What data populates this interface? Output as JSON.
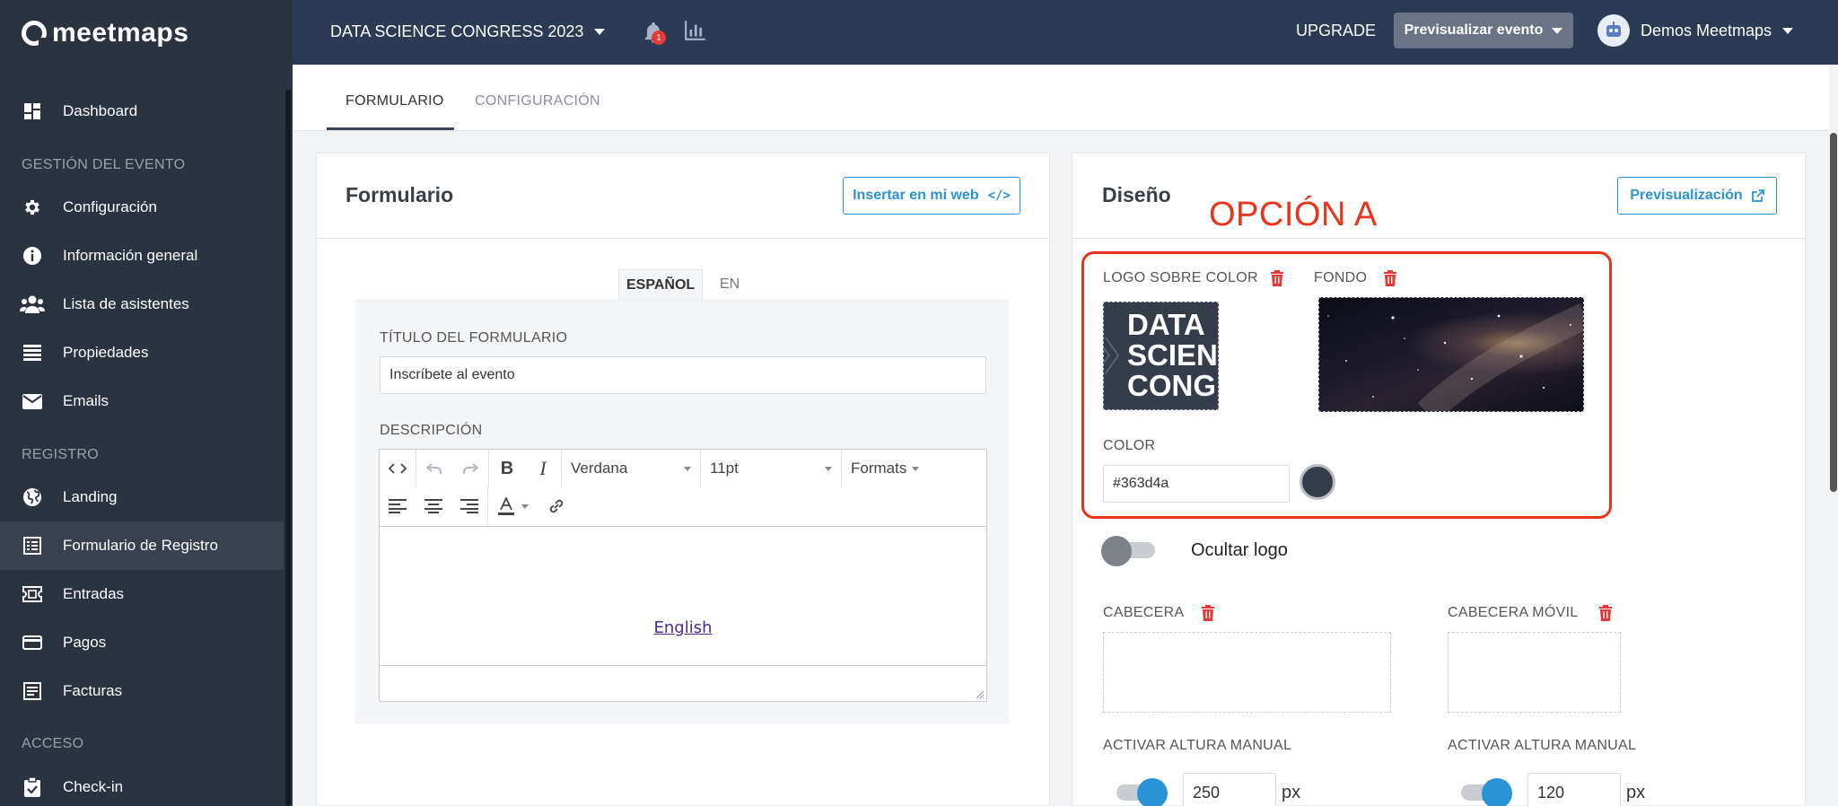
{
  "app": {
    "logo_text": "meetmaps"
  },
  "sidebar": {
    "items": [
      {
        "label": "Dashboard",
        "icon": "dashboard-icon"
      },
      {
        "label": "Configuración",
        "icon": "gear-icon"
      },
      {
        "label": "Información general",
        "icon": "info-icon"
      },
      {
        "label": "Lista de asistentes",
        "icon": "users-icon"
      },
      {
        "label": "Propiedades",
        "icon": "list-icon"
      },
      {
        "label": "Emails",
        "icon": "mail-icon"
      },
      {
        "label": "Landing",
        "icon": "globe-icon"
      },
      {
        "label": "Formulario de Registro",
        "icon": "form-icon"
      },
      {
        "label": "Entradas",
        "icon": "ticket-icon"
      },
      {
        "label": "Pagos",
        "icon": "card-icon"
      },
      {
        "label": "Facturas",
        "icon": "invoice-icon"
      },
      {
        "label": "Check-in",
        "icon": "clipboard-check-icon"
      }
    ],
    "sections": [
      "GESTIÓN DEL EVENTO",
      "REGISTRO",
      "ACCESO"
    ],
    "active_item": "Formulario de Registro"
  },
  "topbar": {
    "event_title": "DATA SCIENCE CONGRESS 2023",
    "notifications_count": "1",
    "upgrade": "UPGRADE",
    "preview_event": "Previsualizar evento",
    "user_name": "Demos Meetmaps"
  },
  "tabs": [
    "FORMULARIO",
    "CONFIGURACIÓN"
  ],
  "form_card": {
    "title": "Formulario",
    "embed_button": "Insertar en mi web",
    "lang_tabs": [
      "ESPAÑOL",
      "EN"
    ],
    "form_title_label": "TÍTULO DEL FORMULARIO",
    "form_title_value": "Inscríbete al evento",
    "description_label": "DESCRIPCIÓN",
    "editor": {
      "font": "Verdana",
      "size": "11pt",
      "formats": "Formats",
      "content_link": "English"
    }
  },
  "design_card": {
    "title": "Diseño",
    "preview_button": "Previsualización",
    "annotation": "OPCIÓN A",
    "logo_label": "LOGO SOBRE COLOR",
    "logo_text_lines": [
      "DATA",
      "SCIEN",
      "CONGR"
    ],
    "background_label": "FONDO",
    "color_label": "COLOR",
    "color_value": "#363d4a",
    "hide_logo_label": "Ocultar logo",
    "hide_logo_on": false,
    "header_label": "CABECERA",
    "header_mobile_label": "CABECERA MÓVIL",
    "manual_height_label": "ACTIVAR ALTURA MANUAL",
    "manual_height_mobile_label": "ACTIVAR ALTURA MANUAL",
    "header_height": "250",
    "header_mobile_height": "120",
    "unit": "px"
  },
  "colors": {
    "sidebar": "#2b3240",
    "topbar": "#2b3a55",
    "accent": "#2a93d5",
    "annotation": "#e8341c",
    "trash": "#e53935"
  }
}
